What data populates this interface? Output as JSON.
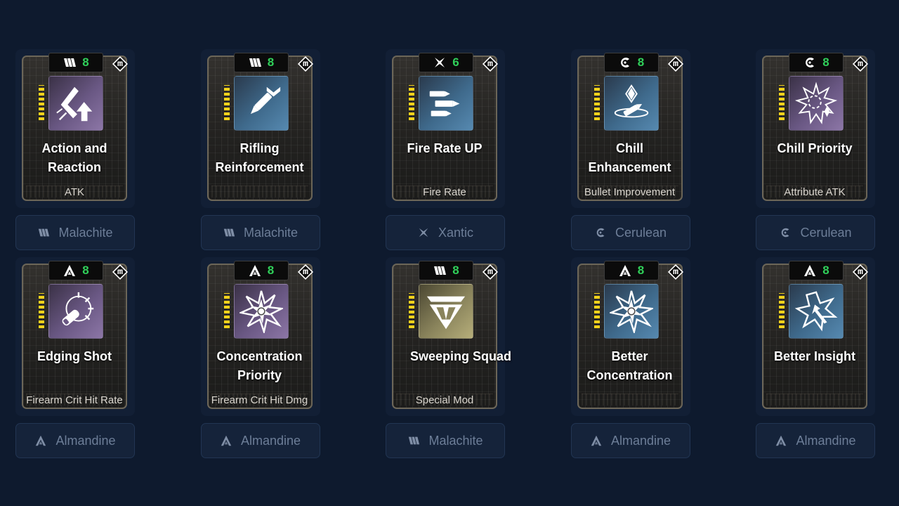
{
  "modules": [
    {
      "title": "Action and Reaction",
      "stat": "ATK",
      "cost": "8",
      "element": "Malachite",
      "element_icon": "malachite-icon",
      "art": "purple",
      "art_icon": "action-reaction-art-icon"
    },
    {
      "title": "Rifling Reinforcement",
      "stat": "",
      "cost": "8",
      "element": "Malachite",
      "element_icon": "malachite-icon",
      "art": "blue",
      "art_icon": "rifling-art-icon"
    },
    {
      "title": "Fire Rate UP",
      "stat": "Fire Rate",
      "cost": "6",
      "element": "Xantic",
      "element_icon": "xantic-icon",
      "art": "blue",
      "art_icon": "bullets-art-icon"
    },
    {
      "title": "Chill Enhancement",
      "stat": "Bullet Improvement",
      "cost": "8",
      "element": "Cerulean",
      "element_icon": "cerulean-icon",
      "art": "blue",
      "art_icon": "chill-bullet-art-icon"
    },
    {
      "title": "Chill Priority",
      "stat": "Attribute ATK",
      "cost": "8",
      "element": "Cerulean",
      "element_icon": "cerulean-icon",
      "art": "purple",
      "art_icon": "chill-burst-art-icon"
    },
    {
      "title": "Edging Shot",
      "stat": "Firearm Crit Hit Rate",
      "cost": "8",
      "element": "Almandine",
      "element_icon": "almandine-icon",
      "art": "purple",
      "art_icon": "edging-shot-art-icon"
    },
    {
      "title": "Concentration Priority",
      "stat": "Firearm Crit Hit Dmg",
      "cost": "8",
      "element": "Almandine",
      "element_icon": "almandine-icon",
      "art": "purple",
      "art_icon": "star-burst-art-icon"
    },
    {
      "title": "Sweeping Squad",
      "stat": "Special Mod",
      "cost": "8",
      "element": "Malachite",
      "element_icon": "malachite-icon",
      "art": "gold",
      "art_icon": "squad-emblem-art-icon"
    },
    {
      "title": "Better Concentration",
      "stat": "",
      "cost": "8",
      "element": "Almandine",
      "element_icon": "almandine-icon",
      "art": "blue",
      "art_icon": "star-burst-art-icon"
    },
    {
      "title": "Better Insight",
      "stat": "",
      "cost": "8",
      "element": "Almandine",
      "element_icon": "almandine-icon",
      "art": "blue",
      "art_icon": "insight-burst-art-icon"
    }
  ],
  "colors": {
    "background": "#0e1a2e",
    "cost_text": "#30d05a",
    "element_label": "#6d7e98",
    "pins": "#f2d21c"
  }
}
